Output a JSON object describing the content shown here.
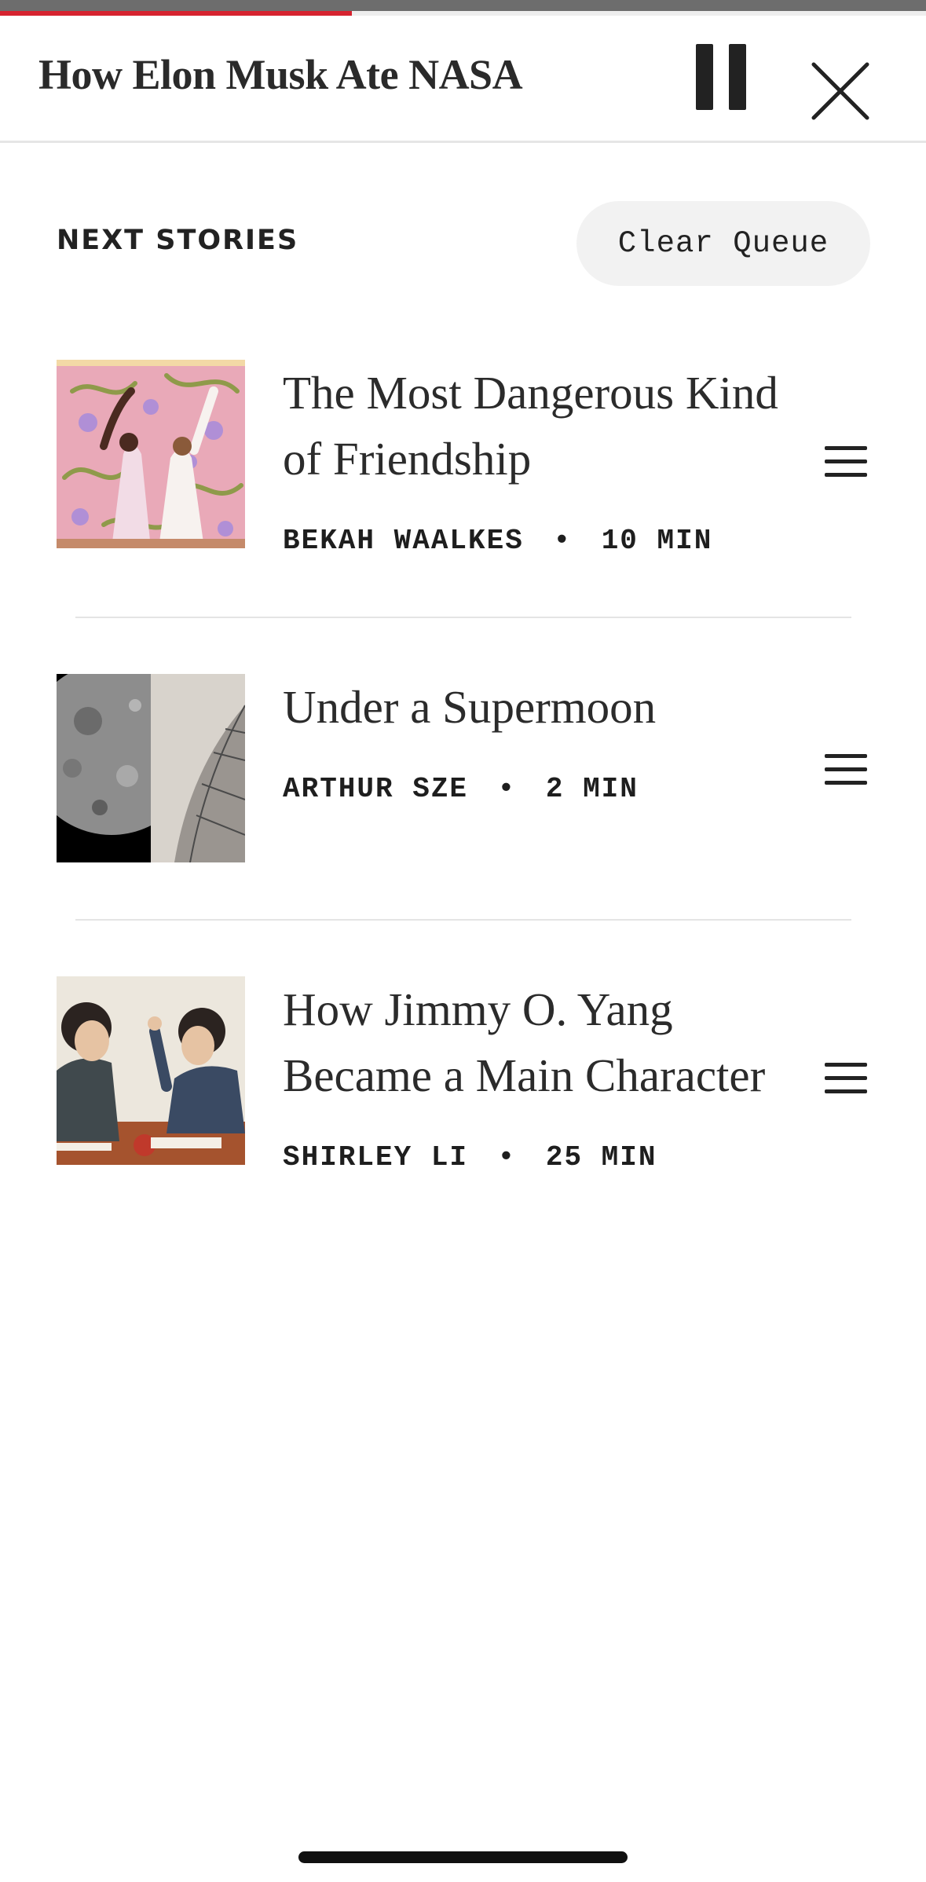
{
  "player": {
    "progress_percent": 38,
    "now_playing_title": "How Elon Musk Ate NASA",
    "pause_icon": "pause-icon",
    "close_icon": "close-icon",
    "accent_color": "#d6232f"
  },
  "queue": {
    "heading": "NEXT STORIES",
    "clear_label": "Clear Queue",
    "stories": [
      {
        "title": "The Most Dangerous Kind of Friendship",
        "author": "BEKAH WAALKES",
        "duration": "10 MIN"
      },
      {
        "title": "Under a Supermoon",
        "author": "ARTHUR SZE",
        "duration": "2 MIN"
      },
      {
        "title": "How Jimmy O. Yang Became a Main Character",
        "author": "SHIRLEY LI",
        "duration": "25 MIN"
      }
    ],
    "meta_separator": "•",
    "drag_icon": "drag-handle-icon"
  }
}
